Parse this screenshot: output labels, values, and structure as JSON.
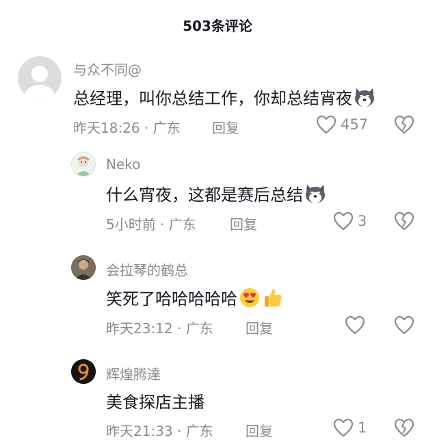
{
  "header": {
    "title": "503条评论"
  },
  "comments": [
    {
      "username": "与众不同@",
      "text": "总经理，叫你总结工作，你却总结宵夜",
      "time": "昨天18:26",
      "location": "广东",
      "reply_label": "回复",
      "likes": "457"
    },
    {
      "username": "Neko",
      "text": "什么宵夜，这都是赛后总结",
      "time": "5小时前",
      "location": "广东",
      "reply_label": "回复",
      "likes": "3"
    },
    {
      "username": "会拉琴的鹤总",
      "text": "笑死了哈哈哈哈哈",
      "time": "昨天23:12",
      "location": "广东",
      "reply_label": "回复",
      "likes": ""
    },
    {
      "username": "辉煌腾達",
      "text": "美食探店主播",
      "time": "昨天21:33",
      "location": "广东",
      "reply_label": "回复",
      "likes": "1"
    }
  ],
  "separator": " · ",
  "colors": {
    "secondary_text": "#8a8b91",
    "primary_text": "#161823"
  },
  "icons": [
    "default-avatar-icon",
    "husky-emoji-icon",
    "heart-eyes-emoji-icon",
    "thumbs-up-emoji-icon",
    "like-heart-icon",
    "dislike-broken-heart-icon"
  ]
}
